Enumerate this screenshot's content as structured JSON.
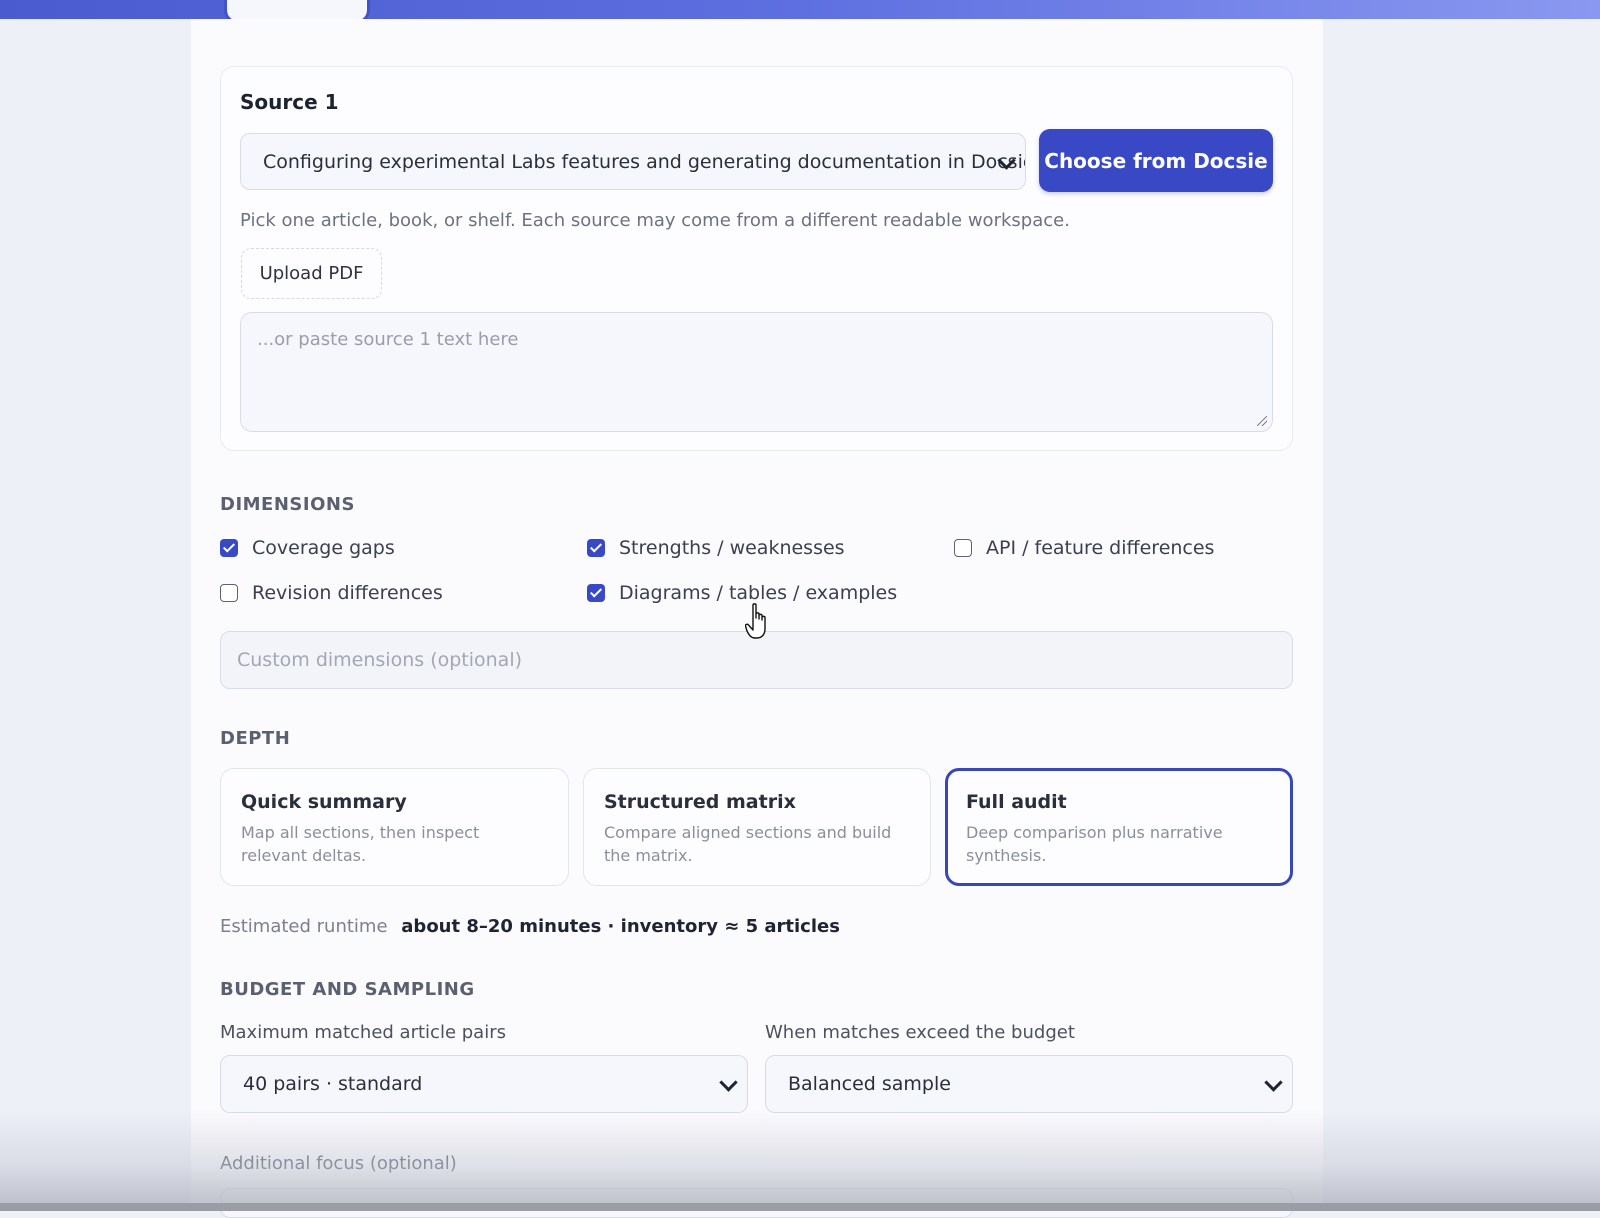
{
  "source": {
    "title": "Source 1",
    "selected_value": "Configuring experimental Labs features and generating documentation in Docsie",
    "choose_button": "Choose from Docsie",
    "hint": "Pick one article, book, or shelf. Each source may come from a different readable workspace.",
    "upload_button": "Upload PDF",
    "paste_placeholder": "...or paste source 1 text here"
  },
  "dimensions": {
    "heading": "DIMENSIONS",
    "options": [
      {
        "label": "Coverage gaps",
        "checked": true
      },
      {
        "label": "Strengths / weaknesses",
        "checked": true
      },
      {
        "label": "API / feature differences",
        "checked": false
      },
      {
        "label": "Revision differences",
        "checked": false
      },
      {
        "label": "Diagrams / tables / examples",
        "checked": true
      }
    ],
    "custom_placeholder": "Custom dimensions (optional)"
  },
  "depth": {
    "heading": "DEPTH",
    "cards": [
      {
        "title": "Quick summary",
        "desc": "Map all sections, then inspect relevant deltas.",
        "selected": false
      },
      {
        "title": "Structured matrix",
        "desc": "Compare aligned sections and build the matrix.",
        "selected": false
      },
      {
        "title": "Full audit",
        "desc": "Deep comparison plus narrative synthesis.",
        "selected": true
      }
    ]
  },
  "runtime": {
    "label": "Estimated runtime",
    "value": "about 8–20 minutes · inventory ≈ 5 articles"
  },
  "budget": {
    "heading": "BUDGET AND SAMPLING",
    "pairs_label": "Maximum matched article pairs",
    "pairs_value": "40 pairs · standard",
    "exceed_label": "When matches exceed the budget",
    "exceed_value": "Balanced sample",
    "focus_label": "Additional focus (optional)"
  },
  "colors": {
    "accent": "#3949c6",
    "topbar": "#5e6fe0",
    "background": "#eef0f8"
  }
}
